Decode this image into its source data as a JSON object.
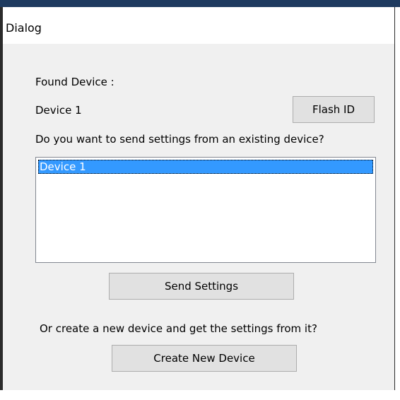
{
  "window": {
    "title": "Dialog"
  },
  "found_device": {
    "label": "Found Device :",
    "name": "Device 1"
  },
  "flash_id_button": "Flash ID",
  "question_existing": "Do you want to send settings from an existing device?",
  "device_list": {
    "items": [
      {
        "label": "Device 1",
        "selected": true
      }
    ]
  },
  "send_settings_button": "Send Settings",
  "question_new": "Or create a new device and get the settings from it?",
  "create_new_device_button": "Create New Device"
}
